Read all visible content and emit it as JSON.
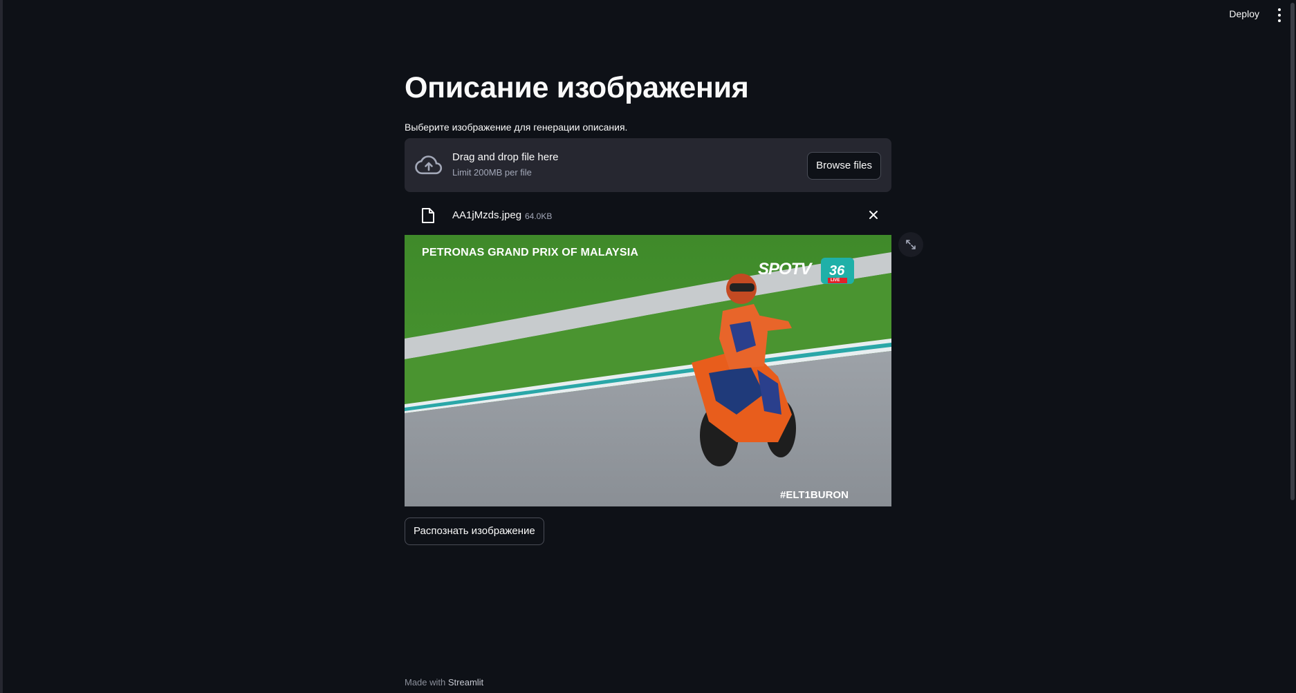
{
  "header": {
    "deploy_label": "Deploy",
    "menu_icon": "kebab-menu-icon"
  },
  "main": {
    "title": "Описание изображения",
    "uploader_label": "Выберите изображение для генерации описания."
  },
  "uploader": {
    "drag_text": "Drag and drop file here",
    "limit_text": "Limit 200MB per file",
    "browse_label": "Browse files",
    "icon": "cloud-upload-icon"
  },
  "file": {
    "name": "AA1jMzds.jpeg",
    "size": "64.0KB",
    "icon": "file-icon",
    "remove_icon": "close-icon"
  },
  "image": {
    "overlay_title": "PETRONAS GRAND PRIX OF MALAYSIA",
    "broadcaster": "SPOTV",
    "channel": "36",
    "channel_tag": "LIVE",
    "hashtag": "#ELT1BURON",
    "fullscreen_icon": "expand-icon"
  },
  "actions": {
    "recognize_label": "Распознать изображение"
  },
  "footer": {
    "prefix": "Made with",
    "brand": "Streamlit"
  },
  "colors": {
    "background": "#0e1117",
    "panel": "#262730",
    "text": "#fafafa",
    "muted": "#a3a8b8"
  }
}
